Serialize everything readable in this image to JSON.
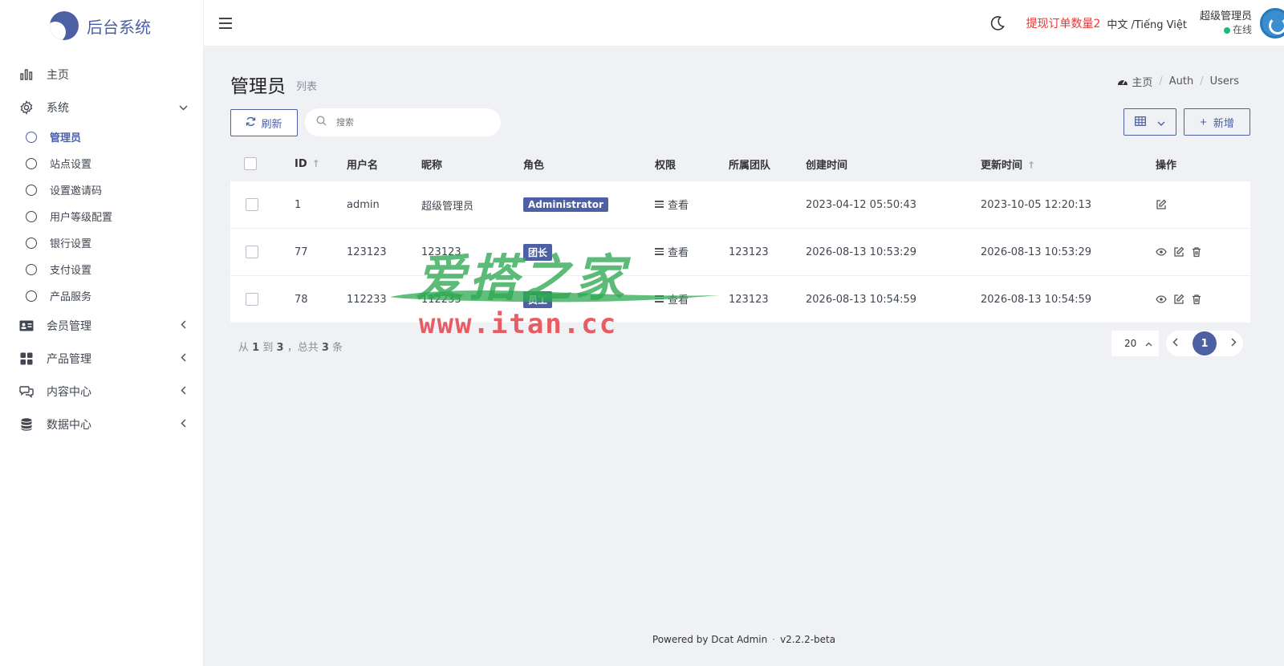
{
  "brand": {
    "name": "后台系统"
  },
  "sidebar": {
    "items": [
      {
        "label": "主页",
        "icon": "chart-bar-icon"
      },
      {
        "label": "系统",
        "icon": "gear-icon",
        "expanded": true,
        "children": [
          {
            "label": "管理员",
            "active": true
          },
          {
            "label": "站点设置"
          },
          {
            "label": "设置邀请码"
          },
          {
            "label": "用户等级配置"
          },
          {
            "label": "银行设置"
          },
          {
            "label": "支付设置"
          },
          {
            "label": "产品服务"
          }
        ]
      },
      {
        "label": "会员管理",
        "icon": "id-card-icon"
      },
      {
        "label": "产品管理",
        "icon": "grid-icon"
      },
      {
        "label": "内容中心",
        "icon": "comments-icon"
      },
      {
        "label": "数据中心",
        "icon": "database-icon"
      }
    ]
  },
  "navbar": {
    "withdraw_notice": "提现订单数量2",
    "language": "中文 /Tiếng Việt",
    "user_name": "超级管理员",
    "user_status": "在线"
  },
  "page": {
    "title": "管理员",
    "subtitle": "列表",
    "breadcrumb": [
      "主页",
      "Auth",
      "Users"
    ]
  },
  "toolbar": {
    "refresh_label": "刷新",
    "search_placeholder": "搜索",
    "add_label": "新增"
  },
  "table": {
    "headers": {
      "id": "ID",
      "username": "用户名",
      "nickname": "昵称",
      "role": "角色",
      "permission": "权限",
      "team": "所属团队",
      "created": "创建时间",
      "updated": "更新时间",
      "actions": "操作"
    },
    "rows": [
      {
        "id": "1",
        "username": "admin",
        "nickname": "超级管理员",
        "role": "Administrator",
        "permission": "查看",
        "team": "",
        "created": "2023-04-12 05:50:43",
        "updated": "2023-10-05 12:20:13"
      },
      {
        "id": "77",
        "username": "123123",
        "nickname": "123123",
        "role": "团长",
        "permission": "查看",
        "team": "123123",
        "created": "2026-08-13 10:53:29",
        "updated": "2026-08-13 10:53:29"
      },
      {
        "id": "78",
        "username": "112233",
        "nickname": "112233",
        "role": "员工",
        "permission": "查看",
        "team": "123123",
        "created": "2026-08-13 10:54:59",
        "updated": "2026-08-13 10:54:59"
      }
    ]
  },
  "pagination": {
    "summary_from_label": "从",
    "summary_from": "1",
    "summary_to_label": "到",
    "summary_to": "3",
    "summary_total_label": "，总共",
    "summary_total": "3",
    "summary_unit": "条",
    "per_page": "20",
    "current_page": "1"
  },
  "footer": {
    "powered": "Powered by Dcat Admin",
    "version": "v2.2.2-beta"
  },
  "watermark": {
    "text_cn": "爱搭之家",
    "url": "www.itan.cc"
  },
  "colors": {
    "primary": "#4c60a3",
    "danger": "#ef3333",
    "online": "#21b978"
  }
}
